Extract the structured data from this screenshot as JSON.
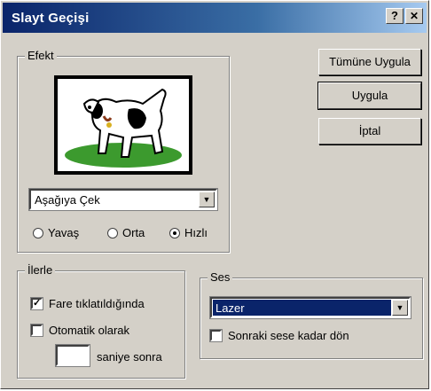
{
  "window": {
    "title": "Slayt Geçişi",
    "help_glyph": "?",
    "close_glyph": "✕"
  },
  "effect_group": {
    "label": "Efekt",
    "combo_value": "Aşağıya Çek",
    "speed_options": [
      {
        "label": "Yavaş",
        "checked": false
      },
      {
        "label": "Orta",
        "checked": false
      },
      {
        "label": "Hızlı",
        "checked": true
      }
    ]
  },
  "buttons": {
    "apply_all": "Tümüne Uygula",
    "apply": "Uygula",
    "cancel": "İptal"
  },
  "advance_group": {
    "label": "İlerle",
    "on_mouse_click": {
      "label": "Fare tıklatıldığında",
      "checked": true
    },
    "automatically": {
      "label": "Otomatik olarak",
      "checked": false
    },
    "seconds_value": "",
    "seconds_after": "saniye sonra"
  },
  "sound_group": {
    "label": "Ses",
    "combo_value": "Lazer",
    "loop_until_next": {
      "label": "Sonraki sese kadar dön",
      "checked": false
    }
  },
  "colors": {
    "dialog_bg": "#d4d0c8",
    "title_start": "#0a246a",
    "selection": "#0a246a",
    "grass": "#3c9a2e"
  },
  "icons": {
    "preview": "dog-picture",
    "combo_arrow": "chevron-down-icon"
  }
}
